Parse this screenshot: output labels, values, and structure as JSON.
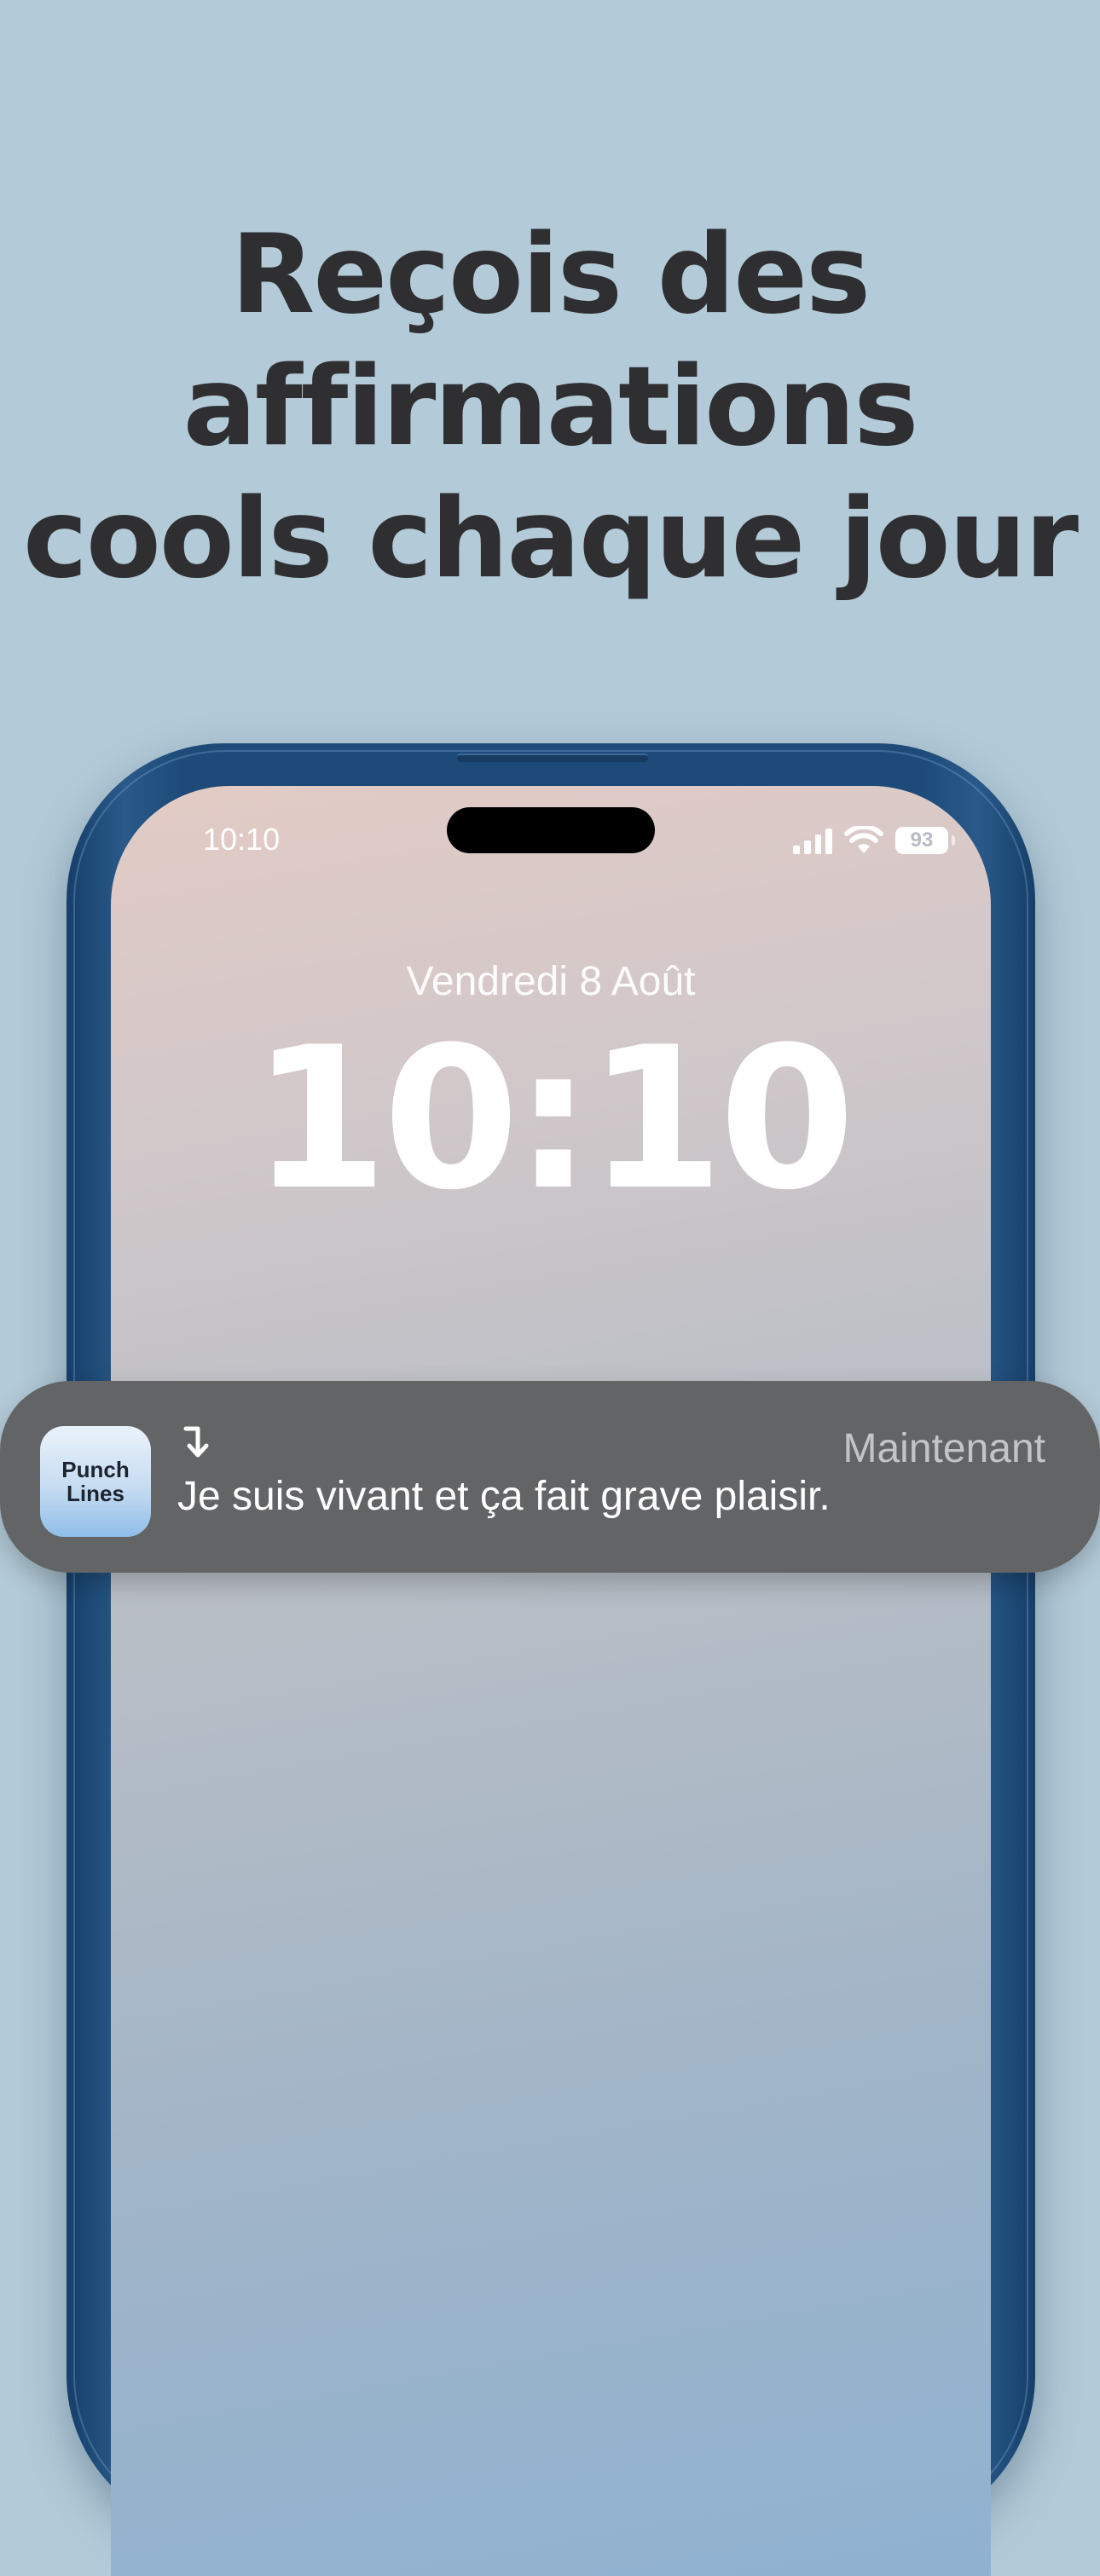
{
  "headline": {
    "line1": "Reçois des",
    "line2": "affirmations",
    "line3": "cools chaque jour"
  },
  "status_bar": {
    "time": "10:10",
    "battery": "93",
    "icons": [
      "cellular-signal-icon",
      "wifi-icon",
      "battery-icon"
    ]
  },
  "lock_screen": {
    "date": "Vendredi 8 Août",
    "time": "10:10"
  },
  "notification": {
    "app_icon_text_line1": "Punch",
    "app_icon_text_line2": "Lines",
    "arrow_icon": "arrow-down-return-icon",
    "timestamp": "Maintenant",
    "message": "Je suis vivant et ça fait grave plaisir."
  },
  "colors": {
    "background": "#b3cad8",
    "headline_text": "#2f2f31",
    "phone_frame": "#1d4a78",
    "notification_bg": "#636466"
  }
}
